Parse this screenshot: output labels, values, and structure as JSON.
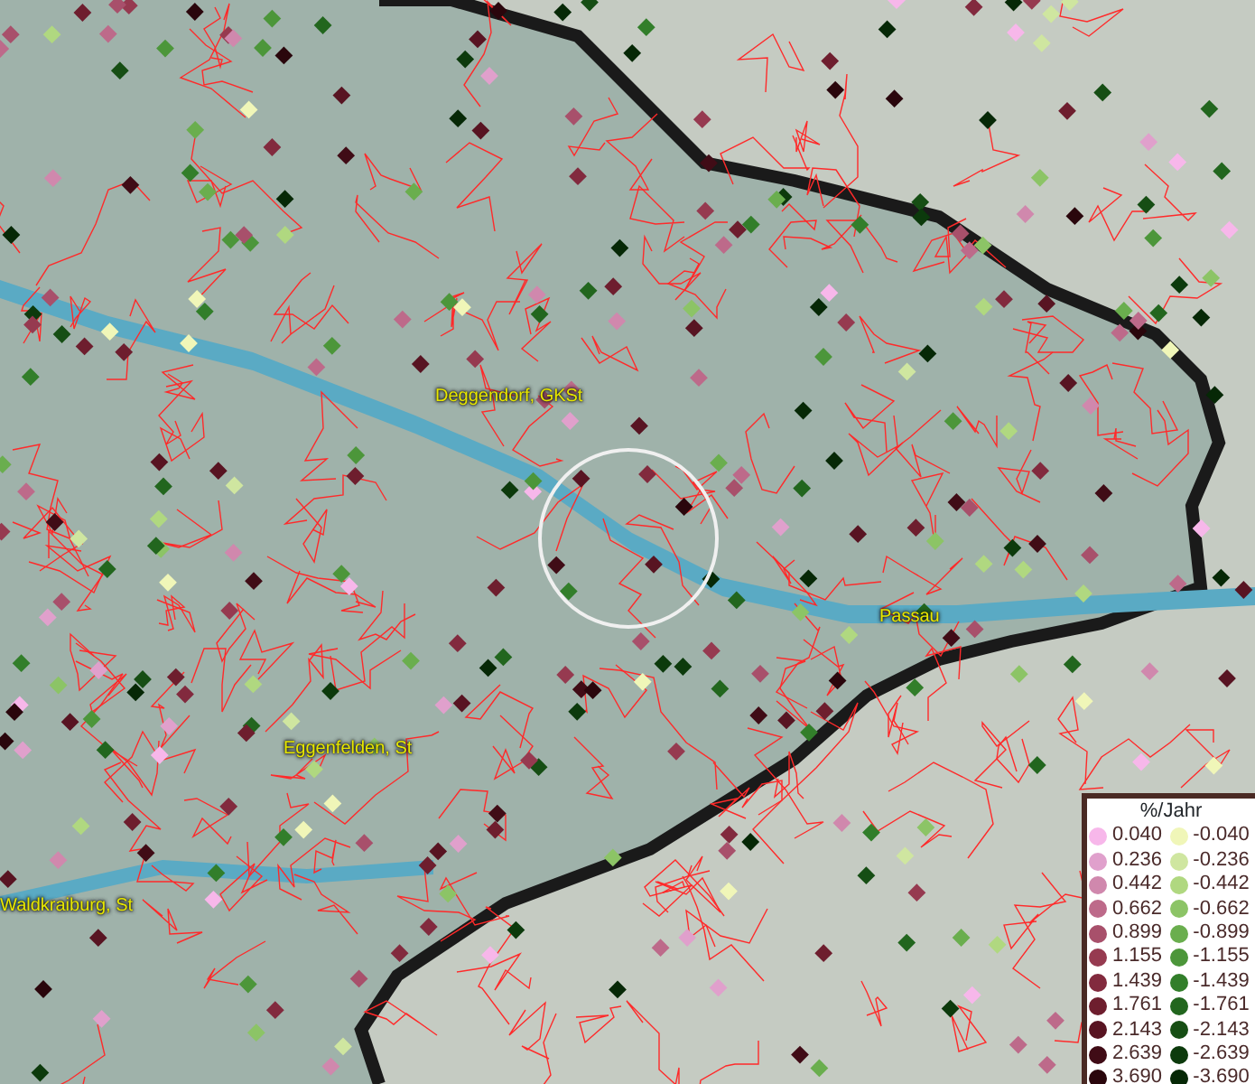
{
  "map": {
    "places": [
      {
        "name": "Deggendorf, GKSt"
      },
      {
        "name": "Passau"
      },
      {
        "name": "Eggenfelden, St"
      },
      {
        "name": "Waldkraiburg, St"
      }
    ]
  },
  "legend": {
    "title": "%/Jahr",
    "positive": [
      {
        "label": "0.040",
        "color": "#f7b7ea"
      },
      {
        "label": "0.236",
        "color": "#e0a0cc"
      },
      {
        "label": "0.442",
        "color": "#d088ad"
      },
      {
        "label": "0.662",
        "color": "#bd6a8a"
      },
      {
        "label": "0.899",
        "color": "#a8506b"
      },
      {
        "label": "1.155",
        "color": "#963a50"
      },
      {
        "label": "1.439",
        "color": "#822a3e"
      },
      {
        "label": "1.761",
        "color": "#6e1e2e"
      },
      {
        "label": "2.143",
        "color": "#581422"
      },
      {
        "label": "2.639",
        "color": "#400c16"
      },
      {
        "label": "3.690",
        "color": "#2a060c"
      }
    ],
    "negative": [
      {
        "label": "-0.040",
        "color": "#f0f6b8"
      },
      {
        "label": "-0.236",
        "color": "#cfe6a0"
      },
      {
        "label": "-0.442",
        "color": "#b0d880"
      },
      {
        "label": "-0.662",
        "color": "#8cc466"
      },
      {
        "label": "-0.899",
        "color": "#6aae4e"
      },
      {
        "label": "-1.155",
        "color": "#4c963a"
      },
      {
        "label": "-1.439",
        "color": "#327e2a"
      },
      {
        "label": "-1.761",
        "color": "#22661e"
      },
      {
        "label": "-2.143",
        "color": "#164e14"
      },
      {
        "label": "-2.639",
        "color": "#0c3a0c"
      },
      {
        "label": "-3.690",
        "color": "#062806"
      }
    ]
  }
}
